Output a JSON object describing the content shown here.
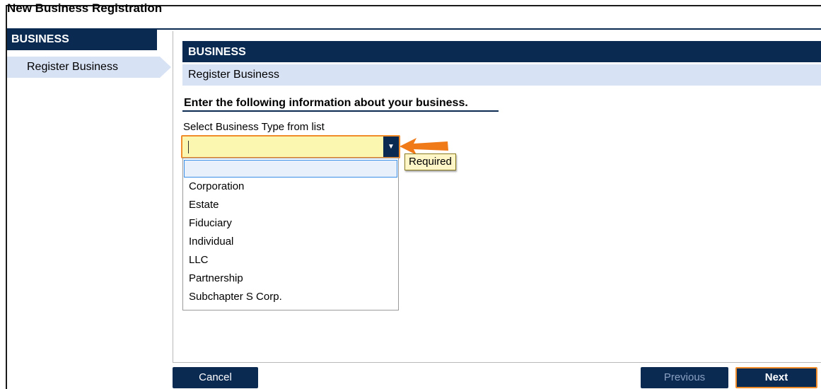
{
  "window": {
    "title": "New Business Registration"
  },
  "sidebar": {
    "header": "BUSINESS",
    "items": [
      {
        "label": "Register Business"
      }
    ]
  },
  "main": {
    "section_header": "BUSINESS",
    "sub_header": "Register Business",
    "instruction": "Enter the following information about your business.",
    "business_type": {
      "label": "Select Business Type from list",
      "value": "",
      "required_tooltip": "Required",
      "options": [
        "",
        "Corporation",
        "Estate",
        "Fiduciary",
        "Individual",
        "LLC",
        "Partnership",
        "Subchapter S Corp."
      ]
    }
  },
  "footer": {
    "cancel_label": "Cancel",
    "previous_label": "Previous",
    "next_label": "Next"
  },
  "colors": {
    "navy": "#0b2a52",
    "light_blue": "#d8e2f5",
    "highlight_orange": "#f08c2a",
    "required_field_yellow": "#fbf6b0"
  }
}
